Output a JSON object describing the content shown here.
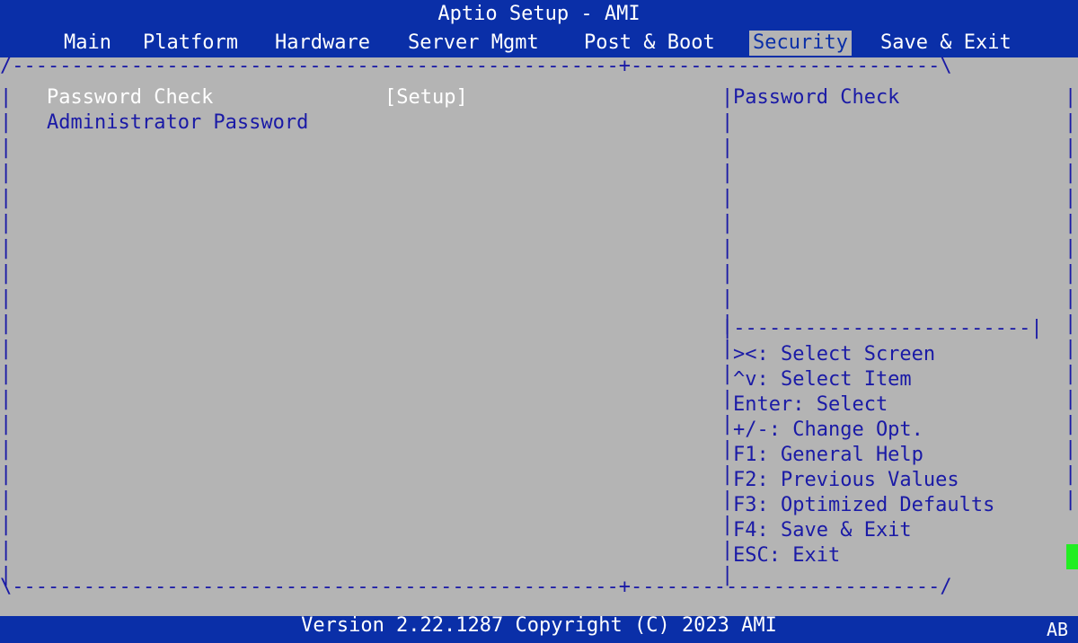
{
  "window": {
    "title": "Aptio Setup - AMI"
  },
  "tabs": [
    {
      "label": "Main",
      "selected": false
    },
    {
      "label": "Platform",
      "selected": false
    },
    {
      "label": "Hardware",
      "selected": false
    },
    {
      "label": "Server Mgmt",
      "selected": false
    },
    {
      "label": "Post & Boot",
      "selected": false
    },
    {
      "label": "Security",
      "selected": true
    },
    {
      "label": "Save & Exit",
      "selected": false
    }
  ],
  "settings": [
    {
      "label": "Password Check",
      "value": "[Setup]",
      "focused": true
    },
    {
      "label": "Administrator Password",
      "value": "",
      "focused": false
    }
  ],
  "help_panel": {
    "description": "Password Check",
    "keys": [
      "><: Select Screen",
      "^v: Select Item",
      "Enter: Select",
      "+/-: Change Opt.",
      "F1: General Help",
      "F2: Previous Values",
      "F3: Optimized Defaults",
      "F4: Save & Exit",
      "ESC: Exit"
    ]
  },
  "footer": {
    "version": "Version 2.22.1287 Copyright (C) 2023 AMI",
    "corner_label": "AB"
  },
  "colors": {
    "background": "#b4b4b4",
    "bar": "#0a2fa8",
    "text": "#1a1aa6",
    "highlight": "#ffffff",
    "cursor": "#22ee22"
  }
}
